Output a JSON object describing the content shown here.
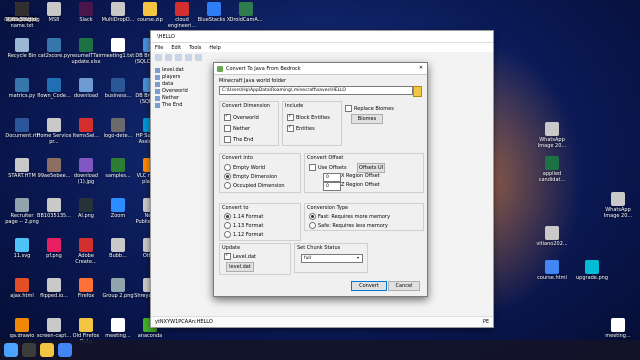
{
  "desktop": {
    "icons": [
      {
        "label": "flippedai.pdf",
        "color": "#d32f2f"
      },
      {
        "label": "MS8",
        "color": "#c9c9c9"
      },
      {
        "label": "Slack",
        "color": "#4a154b"
      },
      {
        "label": "MultiDropD...",
        "color": "#c9c9c9"
      },
      {
        "label": "course.zip",
        "color": "#f4c542"
      },
      {
        "label": "cloud engineeri...",
        "color": "#d32f2f"
      },
      {
        "label": "BlueStacks X",
        "color": "#2e7df6"
      },
      {
        "label": "DroidCamA...",
        "color": "#2f7d4f"
      },
      {
        "label": "Recycle Bin",
        "color": "#9ab7d3"
      },
      {
        "label": "cat2score.py",
        "color": "#3776ab"
      },
      {
        "label": "resumeITTair update.xlsx",
        "color": "#1e7145"
      },
      {
        "label": "meeting1.txt",
        "color": "#ffffff"
      },
      {
        "label": "DB Browser (SQLCipher)",
        "color": "#4a90d9"
      },
      {
        "label": "matrics.py",
        "color": "#3776ab"
      },
      {
        "label": "flown_Code...",
        "color": "#1f6fb2"
      },
      {
        "label": "download",
        "color": "#6d9bd1"
      },
      {
        "label": "business...",
        "color": "#2b5797"
      },
      {
        "label": "DB Browser (SQLite)",
        "color": "#4a90d9"
      },
      {
        "label": "Document.rtf",
        "color": "#2b579a"
      },
      {
        "label": "Home Service pr...",
        "color": "#c9c9c9"
      },
      {
        "label": "ItemsSel...",
        "color": "#d32f2f"
      },
      {
        "label": "logo-dete...",
        "color": "#6b6b6b"
      },
      {
        "label": "HP Support Assistant",
        "color": "#0096d6"
      },
      {
        "label": "START.HTM",
        "color": "#c9c9c9"
      },
      {
        "label": "99ae5ebee...",
        "color": "#8d6e63"
      },
      {
        "label": "download (1).jpg",
        "color": "#7e57c2"
      },
      {
        "label": "samples...",
        "color": "#2e7d32"
      },
      {
        "label": "VLC media player",
        "color": "#ff8800"
      },
      {
        "label": "Recruiter page -- 2.png",
        "color": "#90a4ae"
      },
      {
        "label": "BB1035135...",
        "color": "#c9c9c9"
      },
      {
        "label": "AI.png",
        "color": "#263238"
      },
      {
        "label": "Zoom",
        "color": "#2d8cff"
      },
      {
        "label": "New Published...",
        "color": "#c9c9c9"
      },
      {
        "label": "11.svg",
        "color": "#4fc3f7"
      },
      {
        "label": "pf.png",
        "color": "#e91e63"
      },
      {
        "label": "Adobe Create...",
        "color": "#d32f2f"
      },
      {
        "label": "Bubb...",
        "color": "#c9c9c9"
      },
      {
        "label": "Other",
        "color": "#c9c9c9"
      },
      {
        "label": "ajax.html",
        "color": "#e34f26"
      },
      {
        "label": "flipped.io...",
        "color": "#c9c9c9"
      },
      {
        "label": "Firefox",
        "color": "#ff7139"
      },
      {
        "label": "Group 2.png",
        "color": "#90a4ae"
      },
      {
        "label": "Shreya849...",
        "color": "#c9c9c9"
      },
      {
        "label": "qa.drawio",
        "color": "#f08705"
      },
      {
        "label": "screen-capt...",
        "color": "#c9c9c9"
      },
      {
        "label": "Old Firefox Data",
        "color": "#f4c542"
      },
      {
        "label": "meeting...",
        "color": "#ffffff"
      },
      {
        "label": "anaconda",
        "color": "#43b02a"
      },
      {
        "label": "wan.pdf",
        "color": "#d32f2f"
      },
      {
        "label": "contact us.jpg",
        "color": "#c9c9c9"
      },
      {
        "label": "splitstring.py",
        "color": "#3776ab"
      },
      {
        "label": "gitrepo user name.txt",
        "color": "#ffffff"
      },
      {
        "label": "TestingPage...",
        "color": "#e34f26"
      },
      {
        "label": "ApowerMir...",
        "color": "#5c6bc0"
      },
      {
        "label": "time2.html",
        "color": "#e34f26"
      },
      {
        "label": "OBS Studio",
        "color": "#302e31"
      },
      {
        "label": "WhatsApp Image 20...",
        "color": "#c9c9c9"
      },
      {
        "label": "applied candidat...",
        "color": "#1e7145"
      },
      {
        "label": "WhatsApp Image 20...",
        "color": "#c9c9c9"
      },
      {
        "label": "vitiano202...",
        "color": "#c9c9c9"
      },
      {
        "label": "course.html",
        "color": "#4285f4"
      },
      {
        "label": "upgrade.png",
        "color": "#00bcd4"
      },
      {
        "label": "meeting...",
        "color": "#ffffff"
      }
    ]
  },
  "window": {
    "title": "\\HELLO",
    "menu": [
      "File",
      "Edit",
      "Tools",
      "Help"
    ],
    "tree": [
      "level.dat",
      "players",
      "data",
      "Overworld",
      "Nether",
      "The End"
    ],
    "status_left": "ytNXYW1PCAAn:HELLO",
    "status_right": "PE"
  },
  "dialog": {
    "title": "Convert To Java From Bedrock",
    "close": "✕",
    "folder_label": "Minecraft Java world folder",
    "folder_value": "C:\\Users\\Hp\\AppData\\Roaming\\.minecraft\\saves\\HELLO",
    "convert_dimension": {
      "title": "Convert Dimension",
      "items": [
        {
          "label": "Overworld",
          "checked": true
        },
        {
          "label": "Nether",
          "checked": false
        },
        {
          "label": "The End",
          "checked": false
        }
      ]
    },
    "include": {
      "title": "Include",
      "items": [
        {
          "label": "Block Entities",
          "checked": true
        },
        {
          "label": "Entities",
          "checked": true
        }
      ]
    },
    "replace_biomes": {
      "label": "Replace Biomes",
      "button": "Biomes"
    },
    "convert_into": {
      "title": "Convert into",
      "items": [
        {
          "label": "Empty World",
          "checked": false
        },
        {
          "label": "Empty Dimension",
          "checked": true
        },
        {
          "label": "Occupied Dimension",
          "checked": false
        }
      ]
    },
    "convert_offset": {
      "title": "Convert Offset",
      "use_offsets": "Use Offsets",
      "offsets_button": "Offsets UI",
      "x_label": "X Region Offset",
      "z_label": "Z Region Offset",
      "x_value": "0",
      "z_value": "0"
    },
    "convert_to": {
      "title": "Convert to",
      "items": [
        {
          "label": "1.14 Format",
          "checked": true
        },
        {
          "label": "1.13 Format",
          "checked": false
        },
        {
          "label": "1.12 Format",
          "checked": false
        }
      ]
    },
    "conversion_type": {
      "title": "Conversion Type",
      "items": [
        {
          "label": "Fast: Requires more memory",
          "checked": true
        },
        {
          "label": "Safe: Requires less memory",
          "checked": false
        }
      ]
    },
    "update": {
      "title": "Update",
      "checkbox": "Level.dat",
      "button": "level.dat"
    },
    "chunk_status": {
      "title": "Set Chunk Status",
      "value": "full"
    },
    "convert_button": "Convert",
    "cancel_button": "Cancel"
  }
}
